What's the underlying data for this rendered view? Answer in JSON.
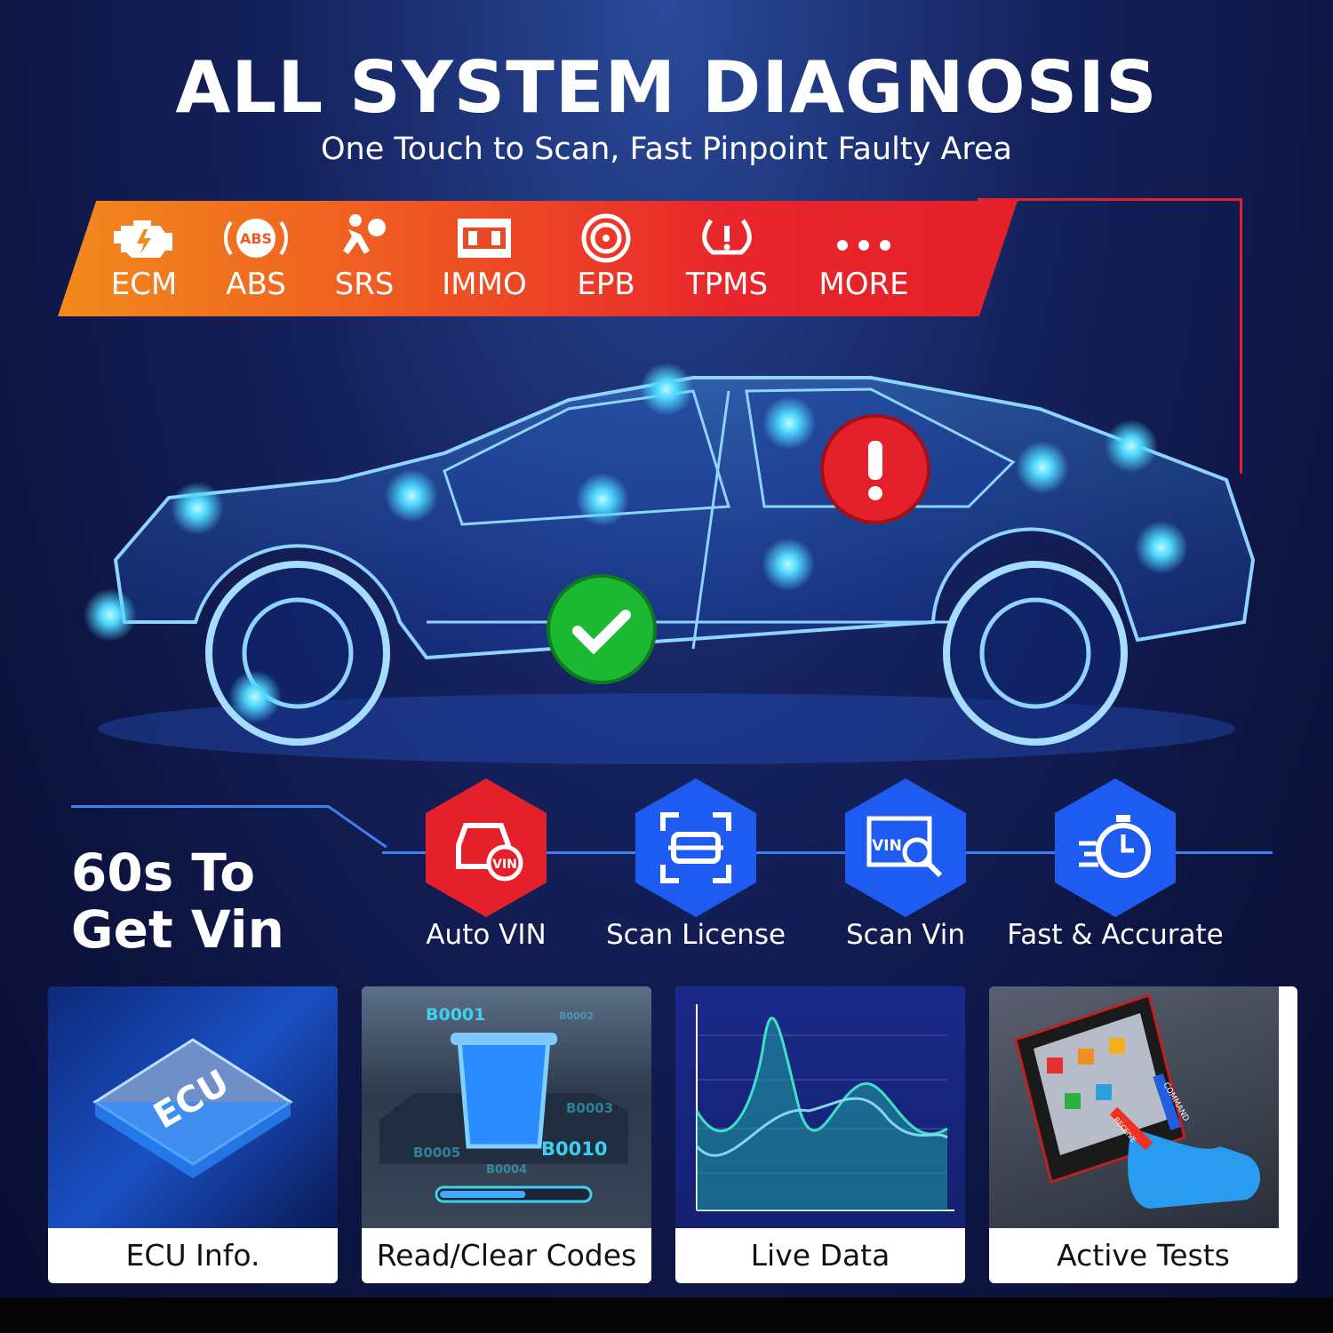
{
  "header": {
    "title": "ALL SYSTEM DIAGNOSIS",
    "subtitle": "One Touch to Scan, Fast Pinpoint Faulty Area"
  },
  "systems": [
    {
      "label": "ECM",
      "icon": "engine-icon"
    },
    {
      "label": "ABS",
      "icon": "abs-icon",
      "icon_text": "ABS"
    },
    {
      "label": "SRS",
      "icon": "airbag-icon"
    },
    {
      "label": "IMMO",
      "icon": "immobilizer-icon"
    },
    {
      "label": "EPB",
      "icon": "parking-brake-icon"
    },
    {
      "label": "TPMS",
      "icon": "tire-pressure-icon"
    },
    {
      "label": "MORE",
      "icon": "more-dots-icon"
    }
  ],
  "car": {
    "status_ok": "check-icon",
    "status_fault": "exclamation-icon"
  },
  "vin": {
    "title_line1": "60s To",
    "title_line2": "Get Vin",
    "features": [
      {
        "label": "Auto VIN",
        "icon": "car-vin-icon",
        "color": "#e4202a",
        "icon_text": "VIN"
      },
      {
        "label": "Scan License",
        "icon": "scan-frame-icon",
        "color": "#1e5bf0"
      },
      {
        "label": "Scan Vin",
        "icon": "vin-search-icon",
        "color": "#1e5bf0",
        "icon_text": "VIN"
      },
      {
        "label": "Fast & Accurate",
        "icon": "stopwatch-icon",
        "color": "#1e5bf0"
      }
    ]
  },
  "cards": [
    {
      "label": "ECU Info.",
      "chip_text": "ECU"
    },
    {
      "label": "Read/Clear Codes",
      "codes": [
        "B0001",
        "B0002",
        "B0003",
        "B0010",
        "B0005",
        "B0004"
      ],
      "progress_percent": 58
    },
    {
      "label": "Live Data"
    },
    {
      "label": "Active Tests",
      "arrow_labels": [
        "COMMAND",
        "RECEIVE"
      ]
    }
  ],
  "colors": {
    "accent_red": "#e4202a",
    "accent_orange": "#f28a1c",
    "accent_blue": "#1e5bf0",
    "node_cyan": "#7ff0ff"
  }
}
